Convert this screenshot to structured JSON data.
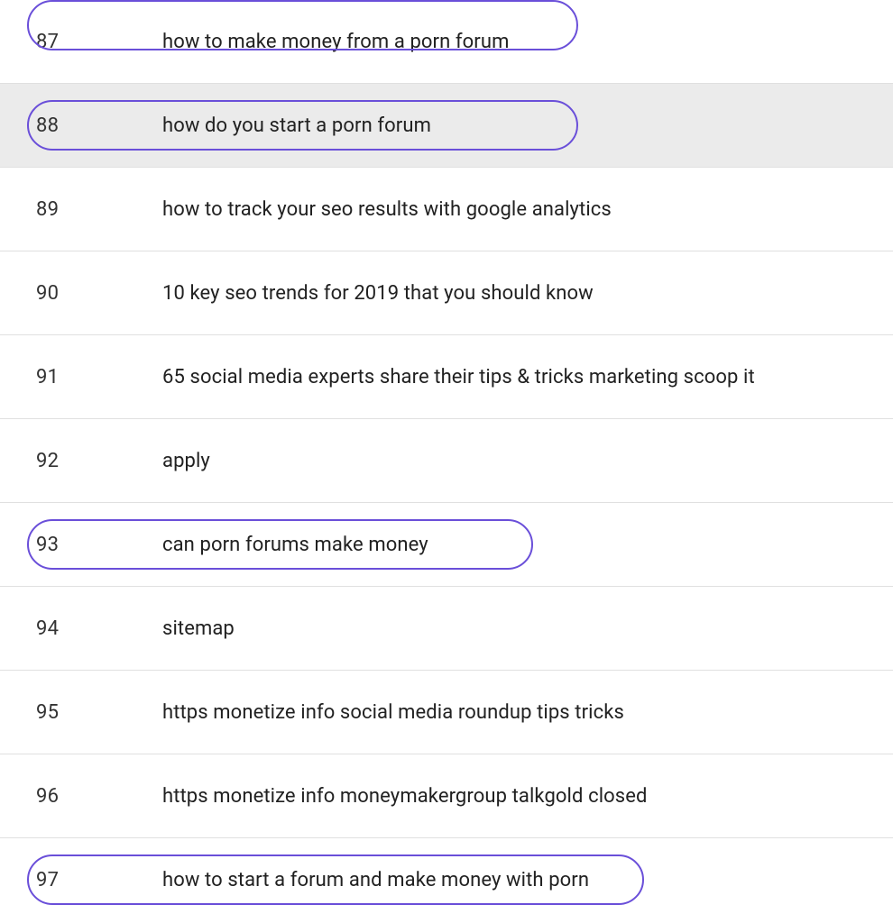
{
  "colors": {
    "highlight_border": "#6a4fd9",
    "row_divider": "#e0e0e0",
    "shaded_bg": "#ebebeb"
  },
  "rows": [
    {
      "num": "87",
      "text": "how to make money from a porn forum",
      "highlighted": true,
      "shaded": false
    },
    {
      "num": "88",
      "text": "how do you start a porn forum",
      "highlighted": true,
      "shaded": true
    },
    {
      "num": "89",
      "text": "how to track your seo results with google analytics",
      "highlighted": false,
      "shaded": false
    },
    {
      "num": "90",
      "text": "10 key seo trends for 2019 that you should know",
      "highlighted": false,
      "shaded": false
    },
    {
      "num": "91",
      "text": "65 social media experts share their tips & tricks marketing scoop it",
      "highlighted": false,
      "shaded": false
    },
    {
      "num": "92",
      "text": "apply",
      "highlighted": false,
      "shaded": false
    },
    {
      "num": "93",
      "text": "can porn forums make money",
      "highlighted": true,
      "shaded": false
    },
    {
      "num": "94",
      "text": "sitemap",
      "highlighted": false,
      "shaded": false
    },
    {
      "num": "95",
      "text": "https monetize info social media roundup tips tricks",
      "highlighted": false,
      "shaded": false
    },
    {
      "num": "96",
      "text": "https monetize info moneymakergroup talkgold closed",
      "highlighted": false,
      "shaded": false
    },
    {
      "num": "97",
      "text": "how to start a forum and make money with porn",
      "highlighted": true,
      "shaded": false
    }
  ]
}
